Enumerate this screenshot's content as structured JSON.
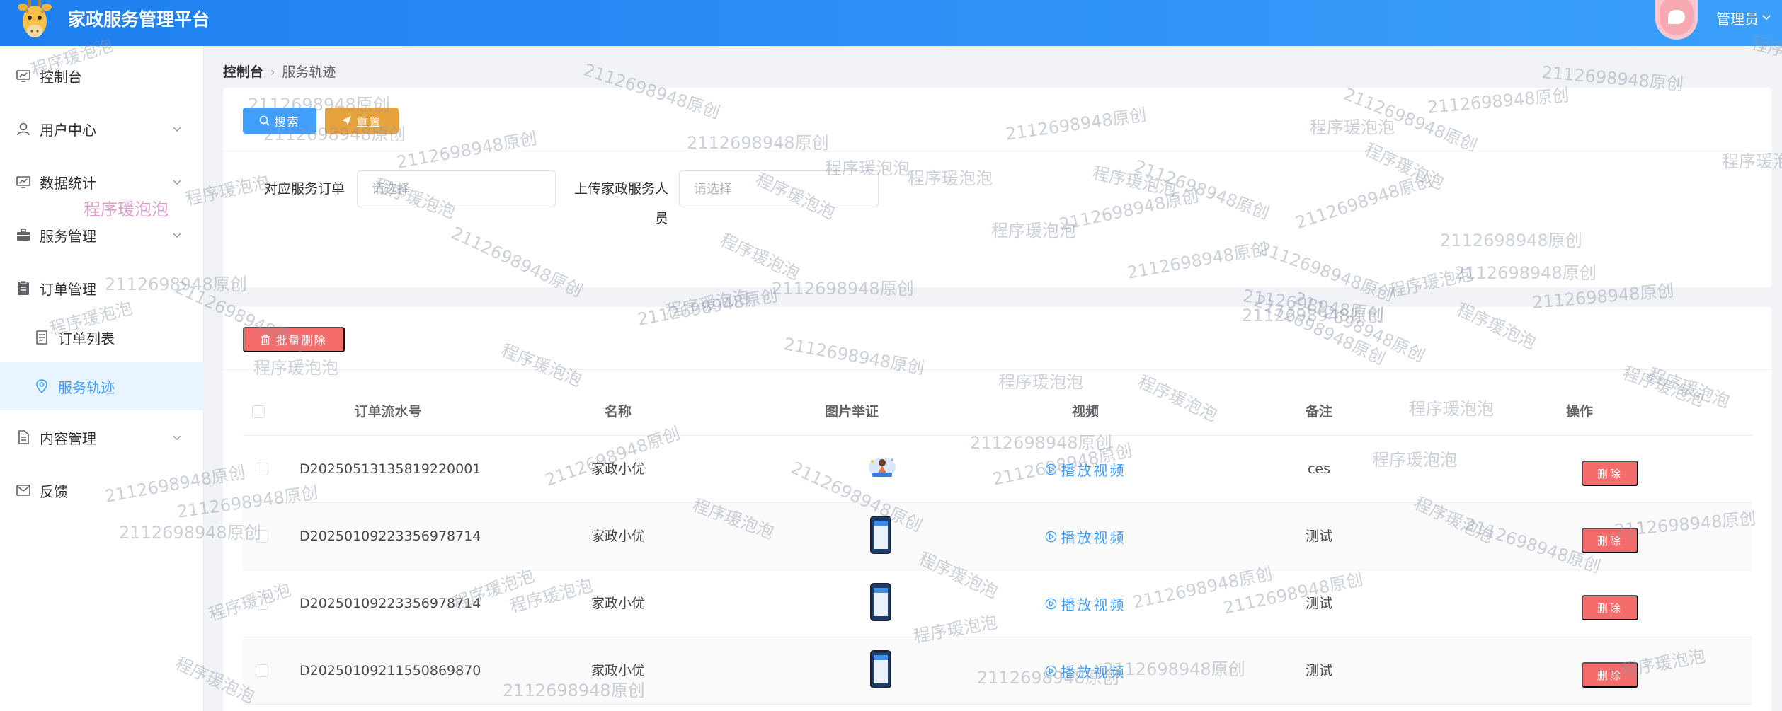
{
  "header": {
    "title": "家政服务管理平台",
    "user_name": "管理员"
  },
  "sidebar": {
    "items": [
      {
        "label": "控制台",
        "icon": "dashboard-icon"
      },
      {
        "label": "用户中心",
        "icon": "user-icon"
      },
      {
        "label": "数据统计",
        "icon": "chart-icon"
      },
      {
        "label": "服务管理",
        "icon": "briefcase-icon"
      },
      {
        "label": "订单管理",
        "icon": "clipboard-icon"
      },
      {
        "label": "订单列表",
        "icon": "document-icon"
      },
      {
        "label": "服务轨迹",
        "icon": "location-icon"
      },
      {
        "label": "内容管理",
        "icon": "file-icon"
      },
      {
        "label": "反馈",
        "icon": "mail-icon"
      }
    ]
  },
  "breadcrumb": {
    "home": "控制台",
    "current": "服务轨迹"
  },
  "search": {
    "search_label": "搜索",
    "reset_label": "重置",
    "field1_label": "对应服务订单",
    "field1_placeholder": "请选择",
    "field2_label_line1": "上传家政服务人",
    "field2_label_line2": "员",
    "field2_placeholder": "请选择"
  },
  "table": {
    "batch_delete_label": "批量删除",
    "columns": [
      "订单流水号",
      "名称",
      "图片举证",
      "视频",
      "备注",
      "操作"
    ],
    "play_label": "播放视频",
    "delete_label": "删除",
    "rows": [
      {
        "order_no": "D20250513135819220001",
        "name": "家政小优",
        "remark": "ces",
        "image": "illustration"
      },
      {
        "order_no": "D20250109223356978714",
        "name": "家政小优",
        "remark": "测试",
        "image": "phone-screenshot"
      },
      {
        "order_no": "D20250109223356978714",
        "name": "家政小优",
        "remark": "测试",
        "image": "phone-screenshot"
      },
      {
        "order_no": "D20250109211550869870",
        "name": "家政小优",
        "remark": "测试",
        "image": "phone-screenshot"
      }
    ]
  },
  "watermark": {
    "id_text": "2112698948原创",
    "name_text": "程序瑗泡泡"
  },
  "colors": {
    "header_start": "#1e7ff0",
    "header_end": "#3aa0fb",
    "primary": "#409eff",
    "warning": "#e6a23c",
    "danger": "#f56c6c",
    "active_bg": "#e8f4ff"
  }
}
